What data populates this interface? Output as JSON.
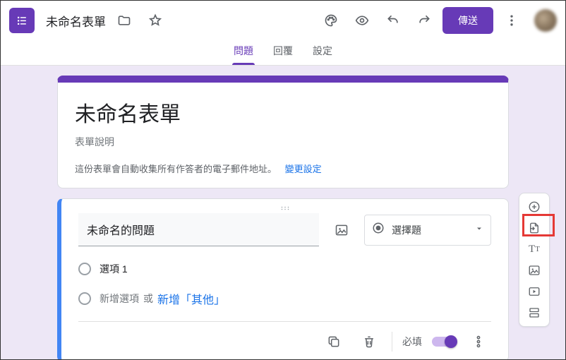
{
  "header": {
    "title": "未命名表單",
    "send_label": "傳送"
  },
  "tabs": {
    "questions": "問題",
    "responses": "回覆",
    "settings": "設定"
  },
  "form": {
    "title": "未命名表單",
    "description": "表單說明",
    "email_note": "這份表單會自動收集所有作答者的電子郵件地址。",
    "change_settings": "變更設定"
  },
  "question": {
    "title": "未命名的問題",
    "type_label": "選擇題",
    "option1": "選項 1",
    "add_option": "新增選項",
    "or": "或",
    "add_other": "新增「其他」",
    "required_label": "必填"
  }
}
